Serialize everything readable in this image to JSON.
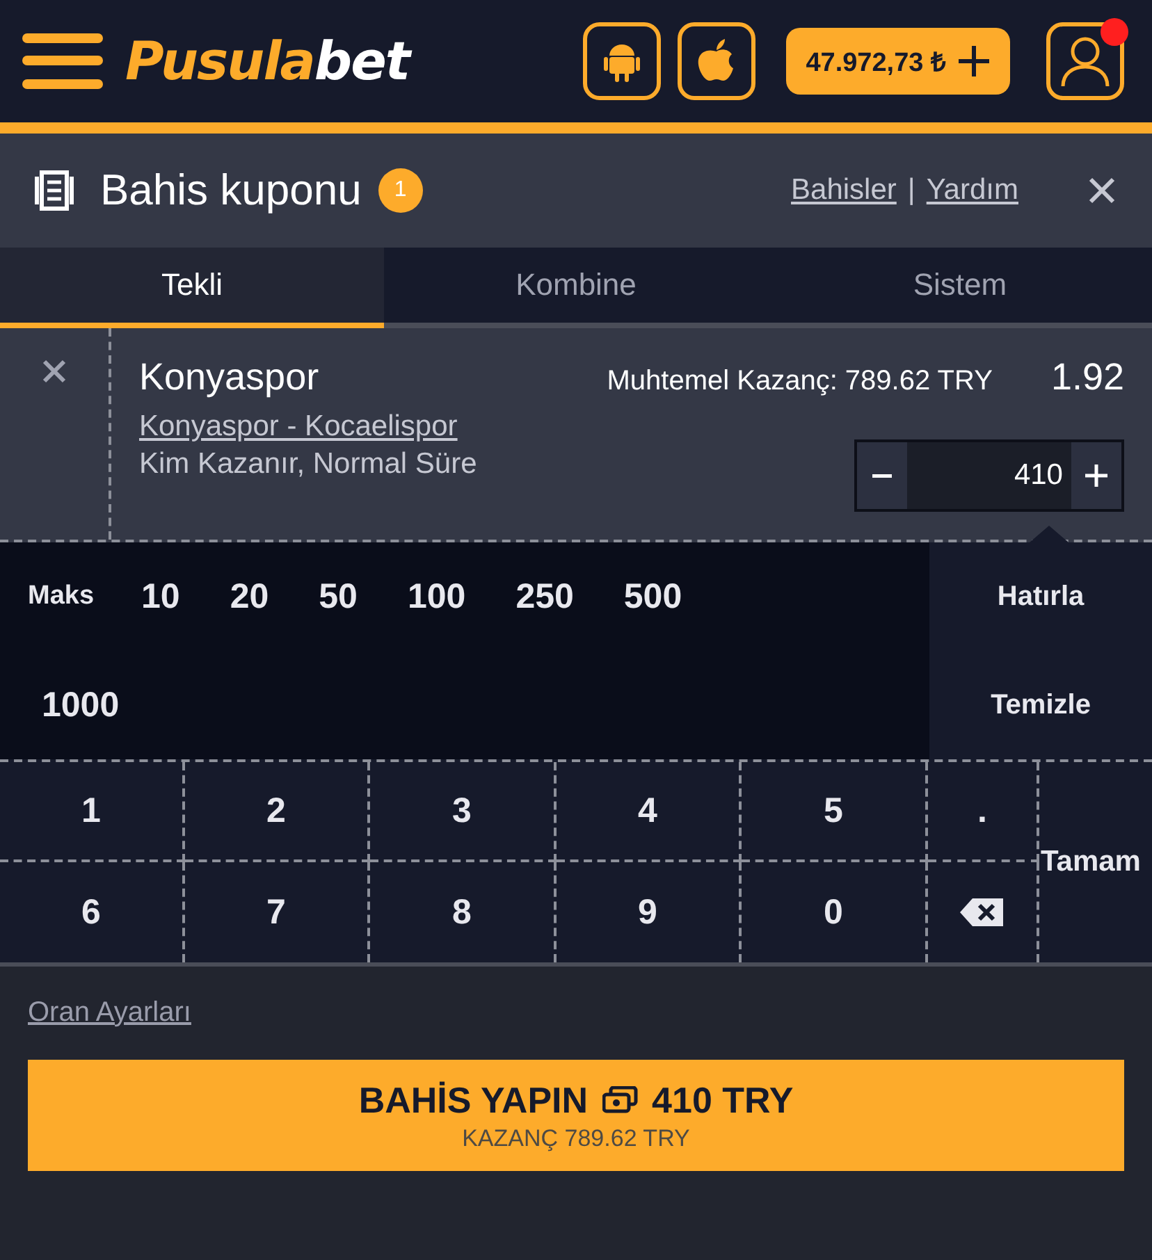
{
  "header": {
    "logo": {
      "text": "Pusula",
      "accent": "bet"
    },
    "balance": "47.972,73 ₺",
    "notification": true
  },
  "coupon": {
    "title": "Bahis kuponu",
    "count": "1",
    "links": [
      "Bahisler",
      "Yardım"
    ],
    "separator": "|"
  },
  "tabs": [
    {
      "label": "Tekli",
      "selected": true
    },
    {
      "label": "Kombine",
      "selected": false
    },
    {
      "label": "Sistem",
      "selected": false
    }
  ],
  "bet": {
    "team": "Konyaspor",
    "match": "Konyaspor - Kocaelispor",
    "market": "Kim Kazanır, Normal Süre",
    "potential": "Muhtemel Kazanç: 789.62 TRY",
    "odds": "1.92",
    "stake": "410"
  },
  "quick_amounts": [
    "Maks",
    "10",
    "20",
    "50",
    "100",
    "250",
    "500",
    "1000"
  ],
  "side_actions": [
    "Hatırla",
    "Temizle"
  ],
  "keypad": {
    "rows": [
      [
        "1",
        "2",
        "3",
        "4",
        "5",
        "."
      ],
      [
        "6",
        "7",
        "8",
        "9",
        "0"
      ]
    ],
    "confirm": "Tamam"
  },
  "footer": {
    "odds_settings": "Oran Ayarları",
    "place_bet": "BAHİS YAPIN",
    "amount": "410 TRY",
    "win": "KAZANÇ 789.62 TRY"
  }
}
